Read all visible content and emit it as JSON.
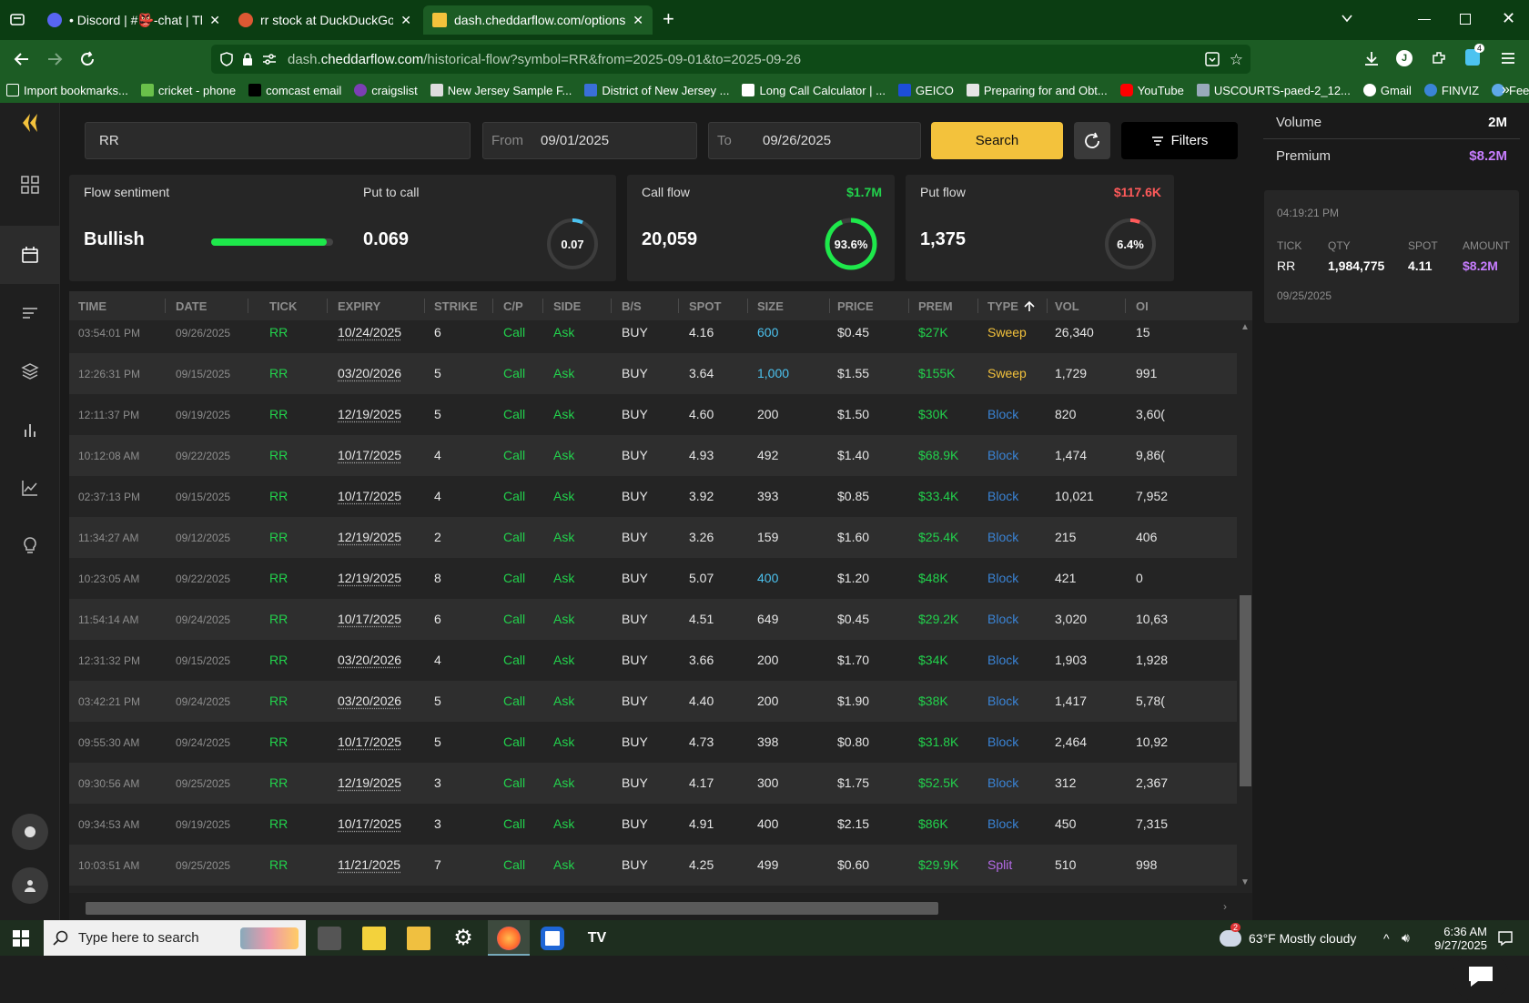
{
  "browser": {
    "tabs": [
      {
        "label": "• Discord | #👺-chat | The Usele",
        "active": false
      },
      {
        "label": "rr stock at DuckDuckGo",
        "active": false
      },
      {
        "label": "dash.cheddarflow.com/options-",
        "active": true
      }
    ],
    "url_prefix": "dash.",
    "url_domain": "cheddarflow.com",
    "url_path": "/historical-flow?symbol=RR&from=2025-09-01&to=2025-09-26",
    "extension_badge": "4",
    "bookmarks": [
      "Import bookmarks...",
      "cricket - phone",
      "comcast email",
      "craigslist",
      "New Jersey Sample F...",
      "District of New Jersey ...",
      "Long Call Calculator | ...",
      "GEICO",
      "Preparing for and Obt...",
      "YouTube",
      "USCOURTS-paed-2_12...",
      "Gmail",
      "FINVIZ",
      "Feed | Utradea"
    ]
  },
  "search": {
    "symbol": "RR",
    "from_label": "From",
    "from_value": "09/01/2025",
    "to_label": "To",
    "to_value": "09/26/2025",
    "search_label": "Search",
    "filters_label": "Filters"
  },
  "cards": {
    "sentiment": {
      "title": "Flow sentiment",
      "value": "Bullish",
      "level": 0.95
    },
    "put_to_call": {
      "title": "Put to call",
      "value": "0.069",
      "ring_label": "0.07",
      "ring_fraction": 0.07
    },
    "call_flow": {
      "title": "Call flow",
      "amount": "$1.7M",
      "value": "20,059",
      "ring_label": "93.6%",
      "ring_fraction": 0.936
    },
    "put_flow": {
      "title": "Put flow",
      "amount": "$117.6K",
      "value": "1,375",
      "ring_label": "6.4%",
      "ring_fraction": 0.064
    }
  },
  "table": {
    "headers": [
      "TIME",
      "DATE",
      "TICK",
      "EXPIRY",
      "STRIKE",
      "C/P",
      "SIDE",
      "B/S",
      "SPOT",
      "SIZE",
      "PRICE",
      "PREM",
      "TYPE",
      "VOL",
      "OI"
    ],
    "rows": [
      [
        "03:54:01 PM",
        "09/26/2025",
        "RR",
        "10/24/2025",
        "6",
        "Call",
        "Ask",
        "BUY",
        "4.16",
        "600",
        "$0.45",
        "$27K",
        "Sweep",
        "26,340",
        "15"
      ],
      [
        "12:26:31 PM",
        "09/15/2025",
        "RR",
        "03/20/2026",
        "5",
        "Call",
        "Ask",
        "BUY",
        "3.64",
        "1,000",
        "$1.55",
        "$155K",
        "Sweep",
        "1,729",
        "991"
      ],
      [
        "12:11:37 PM",
        "09/19/2025",
        "RR",
        "12/19/2025",
        "5",
        "Call",
        "Ask",
        "BUY",
        "4.60",
        "200",
        "$1.50",
        "$30K",
        "Block",
        "820",
        "3,60("
      ],
      [
        "10:12:08 AM",
        "09/22/2025",
        "RR",
        "10/17/2025",
        "4",
        "Call",
        "Ask",
        "BUY",
        "4.93",
        "492",
        "$1.40",
        "$68.9K",
        "Block",
        "1,474",
        "9,86("
      ],
      [
        "02:37:13 PM",
        "09/15/2025",
        "RR",
        "10/17/2025",
        "4",
        "Call",
        "Ask",
        "BUY",
        "3.92",
        "393",
        "$0.85",
        "$33.4K",
        "Block",
        "10,021",
        "7,952"
      ],
      [
        "11:34:27 AM",
        "09/12/2025",
        "RR",
        "12/19/2025",
        "2",
        "Call",
        "Ask",
        "BUY",
        "3.26",
        "159",
        "$1.60",
        "$25.4K",
        "Block",
        "215",
        "406"
      ],
      [
        "10:23:05 AM",
        "09/22/2025",
        "RR",
        "12/19/2025",
        "8",
        "Call",
        "Ask",
        "BUY",
        "5.07",
        "400",
        "$1.20",
        "$48K",
        "Block",
        "421",
        "0"
      ],
      [
        "11:54:14 AM",
        "09/24/2025",
        "RR",
        "10/17/2025",
        "6",
        "Call",
        "Ask",
        "BUY",
        "4.51",
        "649",
        "$0.45",
        "$29.2K",
        "Block",
        "3,020",
        "10,63"
      ],
      [
        "12:31:32 PM",
        "09/15/2025",
        "RR",
        "03/20/2026",
        "4",
        "Call",
        "Ask",
        "BUY",
        "3.66",
        "200",
        "$1.70",
        "$34K",
        "Block",
        "1,903",
        "1,928"
      ],
      [
        "03:42:21 PM",
        "09/24/2025",
        "RR",
        "03/20/2026",
        "5",
        "Call",
        "Ask",
        "BUY",
        "4.40",
        "200",
        "$1.90",
        "$38K",
        "Block",
        "1,417",
        "5,78("
      ],
      [
        "09:55:30 AM",
        "09/24/2025",
        "RR",
        "10/17/2025",
        "5",
        "Call",
        "Ask",
        "BUY",
        "4.73",
        "398",
        "$0.80",
        "$31.8K",
        "Block",
        "2,464",
        "10,92"
      ],
      [
        "09:30:56 AM",
        "09/25/2025",
        "RR",
        "12/19/2025",
        "3",
        "Call",
        "Ask",
        "BUY",
        "4.17",
        "300",
        "$1.75",
        "$52.5K",
        "Block",
        "312",
        "2,367"
      ],
      [
        "09:34:53 AM",
        "09/19/2025",
        "RR",
        "10/17/2025",
        "3",
        "Call",
        "Ask",
        "BUY",
        "4.91",
        "400",
        "$2.15",
        "$86K",
        "Block",
        "450",
        "7,315"
      ],
      [
        "10:03:51 AM",
        "09/25/2025",
        "RR",
        "11/21/2025",
        "7",
        "Call",
        "Ask",
        "BUY",
        "4.25",
        "499",
        "$0.60",
        "$29.9K",
        "Split",
        "510",
        "998"
      ]
    ],
    "highlight_sizes": [
      "600",
      "1,000",
      "400"
    ]
  },
  "summary": {
    "volume_label": "Volume",
    "volume_value": "2M",
    "premium_label": "Premium",
    "premium_value": "$8.2M"
  },
  "trade": {
    "time": "04:19:21 PM",
    "tick_label": "TICK",
    "qty_label": "QTY",
    "spot_label": "SPOT",
    "amount_label": "AMOUNT",
    "tick": "RR",
    "qty": "1,984,775",
    "spot": "4.11",
    "amount": "$8.2M",
    "date": "09/25/2025"
  },
  "taskbar": {
    "search_placeholder": "Type here to search",
    "weather_badge": "2",
    "weather": "63°F  Mostly cloudy",
    "time": "6:36 AM",
    "date": "9/27/2025"
  },
  "colors": {
    "green": "#22d24c",
    "red": "#ff5a5a",
    "gold": "#f3c23c",
    "purple": "#c77dff",
    "blue": "#3a84d6",
    "cyan": "#4cc3f0",
    "sweep": "#f3c23c",
    "split": "#b56be8"
  }
}
